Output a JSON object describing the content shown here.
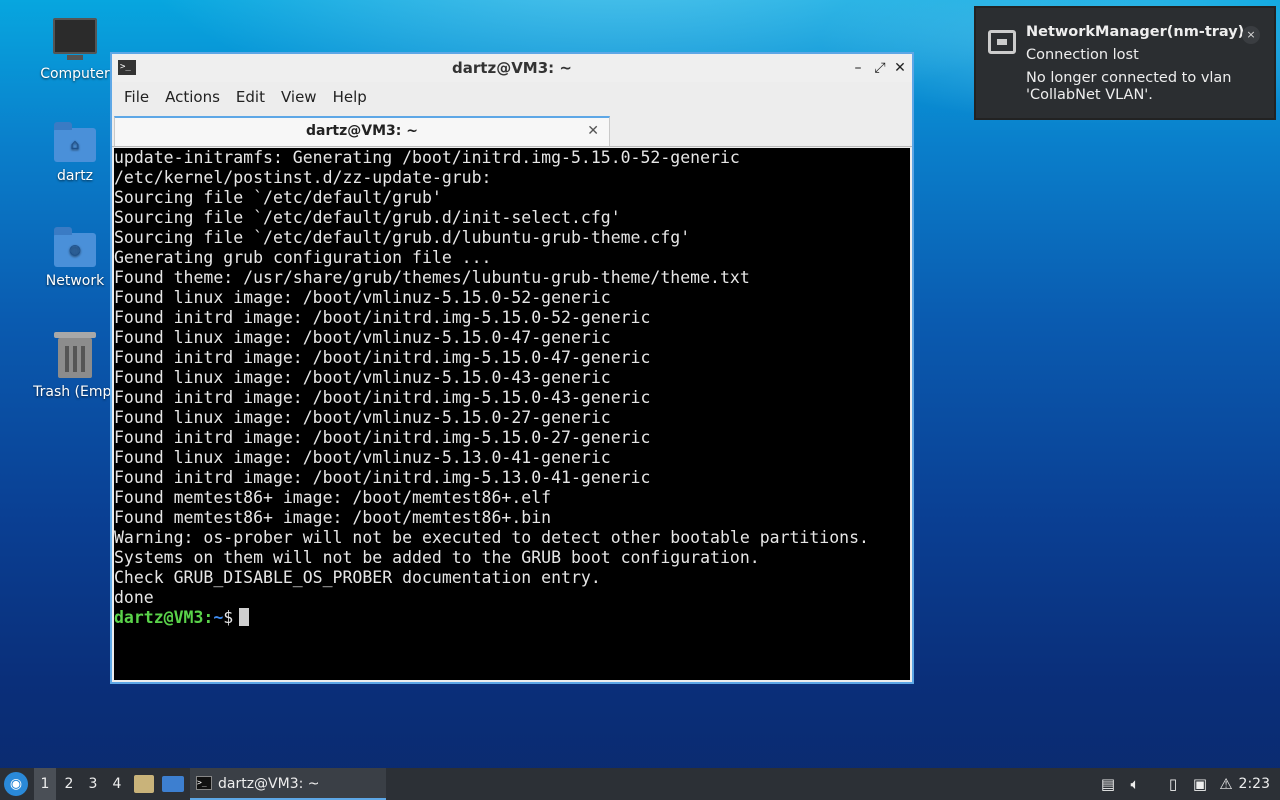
{
  "desktop": {
    "icons": [
      {
        "label": "Computer"
      },
      {
        "label": "dartz"
      },
      {
        "label": "Network"
      },
      {
        "label": "Trash (Empt"
      }
    ]
  },
  "window": {
    "title": "dartz@VM3: ~",
    "controls": {
      "minimize": "–",
      "maximize": "⤢",
      "close": "✕"
    },
    "menu": [
      "File",
      "Actions",
      "Edit",
      "View",
      "Help"
    ],
    "tab": {
      "label": "dartz@VM3: ~",
      "close": "✕"
    }
  },
  "terminal": {
    "lines": [
      "update-initramfs: Generating /boot/initrd.img-5.15.0-52-generic",
      "/etc/kernel/postinst.d/zz-update-grub:",
      "Sourcing file `/etc/default/grub'",
      "Sourcing file `/etc/default/grub.d/init-select.cfg'",
      "Sourcing file `/etc/default/grub.d/lubuntu-grub-theme.cfg'",
      "Generating grub configuration file ...",
      "Found theme: /usr/share/grub/themes/lubuntu-grub-theme/theme.txt",
      "Found linux image: /boot/vmlinuz-5.15.0-52-generic",
      "Found initrd image: /boot/initrd.img-5.15.0-52-generic",
      "Found linux image: /boot/vmlinuz-5.15.0-47-generic",
      "Found initrd image: /boot/initrd.img-5.15.0-47-generic",
      "Found linux image: /boot/vmlinuz-5.15.0-43-generic",
      "Found initrd image: /boot/initrd.img-5.15.0-43-generic",
      "Found linux image: /boot/vmlinuz-5.15.0-27-generic",
      "Found initrd image: /boot/initrd.img-5.15.0-27-generic",
      "Found linux image: /boot/vmlinuz-5.13.0-41-generic",
      "Found initrd image: /boot/initrd.img-5.13.0-41-generic",
      "Found memtest86+ image: /boot/memtest86+.elf",
      "Found memtest86+ image: /boot/memtest86+.bin",
      "Warning: os-prober will not be executed to detect other bootable partitions.",
      "Systems on them will not be added to the GRUB boot configuration.",
      "Check GRUB_DISABLE_OS_PROBER documentation entry.",
      "done"
    ],
    "prompt": {
      "user_host": "dartz@VM3",
      "sep": ":",
      "path": "~",
      "symbol": "$"
    },
    "colors": {
      "user": "#5ad34a",
      "path": "#3f8cf0",
      "bg": "#000000",
      "fg": "#e6e6e6"
    }
  },
  "notification": {
    "app": "NetworkManager(nm-tray)",
    "summary": "Connection lost",
    "body": "No longer connected to vlan 'CollabNet VLAN'.",
    "close": "×",
    "icon": "network-wired-icon"
  },
  "taskbar": {
    "start_icon": "lubuntu-start-icon",
    "workspaces": [
      "1",
      "2",
      "3",
      "4"
    ],
    "active_workspace": "1",
    "task": {
      "label": "dartz@VM3: ~"
    },
    "clock": "2:23"
  },
  "accent": "#5da7e6"
}
